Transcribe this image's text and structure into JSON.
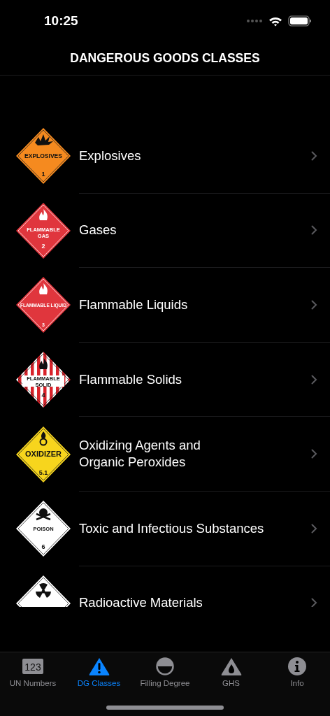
{
  "status_bar": {
    "time": "10:25"
  },
  "nav": {
    "title": "DANGEROUS GOODS CLASSES"
  },
  "classes": [
    {
      "title": "Explosives",
      "placard": {
        "kind": "explosive",
        "color": "#f58a1f",
        "label": [
          "EXPLOSIVES"
        ],
        "number": "1"
      }
    },
    {
      "title": "Gases",
      "placard": {
        "kind": "flame",
        "color": "#e0363d",
        "label": [
          "FLAMMABLE",
          "GAS"
        ],
        "number": "2"
      }
    },
    {
      "title": "Flammable Liquids",
      "placard": {
        "kind": "flame",
        "color": "#e0363d",
        "label": [
          "FLAMMABLE LIQUID"
        ],
        "number": "3"
      }
    },
    {
      "title": "Flammable Solids",
      "placard": {
        "kind": "stripes",
        "color": "#d9222a",
        "label": [
          "FLAMMABLE",
          "SOLID"
        ],
        "number": "4"
      }
    },
    {
      "title": "Oxidizing Agents and\nOrganic Peroxides",
      "placard": {
        "kind": "oxidizer",
        "color": "#f7d51d",
        "label": [
          "OXIDIZER"
        ],
        "number": "5.1"
      }
    },
    {
      "title": "Toxic and Infectious Substances",
      "placard": {
        "kind": "poison",
        "color": "#ffffff",
        "label": [
          "POISON"
        ],
        "number": "6"
      }
    },
    {
      "title": "Radioactive Materials",
      "placard": {
        "kind": "radioactive",
        "color": "#ffffff"
      }
    }
  ],
  "tab_bar": [
    {
      "label": "UN Numbers",
      "kind": "numbers",
      "icon_text": "123",
      "selected": false
    },
    {
      "label": "DG Classes",
      "kind": "warning",
      "selected": true
    },
    {
      "label": "Filling Degree",
      "kind": "half",
      "selected": false
    },
    {
      "label": "GHS",
      "kind": "drop",
      "selected": false
    },
    {
      "label": "Info",
      "kind": "info",
      "selected": false
    }
  ]
}
